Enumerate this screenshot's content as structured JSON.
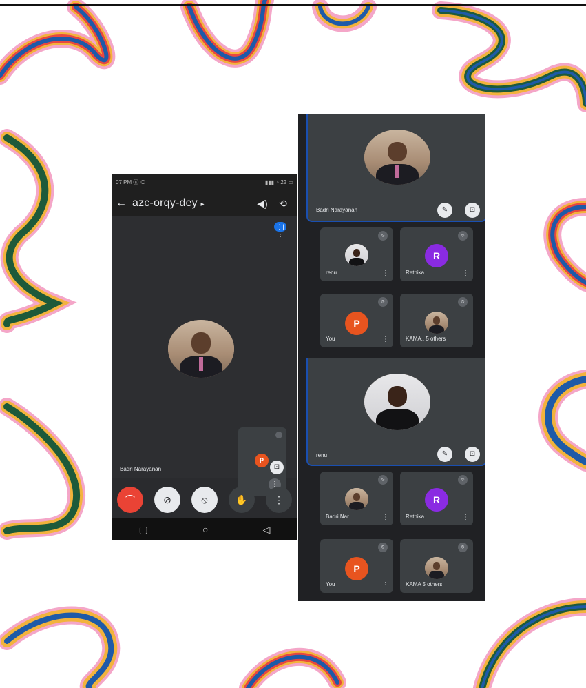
{
  "colors": {
    "accent": "#1a73e8",
    "end_call": "#ea4335",
    "avatar_orange": "#e8541f",
    "avatar_purple": "#8a2be2"
  },
  "phone": {
    "status_left": "07 PM ⓖ ⊙",
    "status_right": "▮▮▮ ◔ 22 ▭",
    "meeting_code": "azc-orqy-dey",
    "meeting_code_chevron": "▸",
    "back_icon": "←",
    "speaker_icon": "◀)",
    "switch_camera_icon": "⟲",
    "speaking_indicator": "⋮|⋮",
    "self_letter": "P",
    "self_more": "⋮",
    "main_name": "Badri Narayanan",
    "pin_icon": "⊡",
    "controls": {
      "end_call": "⌒",
      "camera_off": "⊘",
      "mic_off": "⦸",
      "raise_hand": "✋",
      "more": "⋮"
    },
    "nav": {
      "square": "▢",
      "circle": "○",
      "back": "◁"
    }
  },
  "panel_top": {
    "main_name": "Badri Narayanan",
    "tiles": [
      {
        "name": "renu",
        "letter": ""
      },
      {
        "name": "Rethika",
        "letter": "R"
      },
      {
        "name": "You",
        "letter": "P"
      },
      {
        "name": "KAMA.. 5 others",
        "letter": ""
      }
    ]
  },
  "panel_bottom": {
    "main_name": "renu",
    "tiles": [
      {
        "name": "Badri Nar..",
        "letter": ""
      },
      {
        "name": "Rethika",
        "letter": "R"
      },
      {
        "name": "You",
        "letter": "P"
      },
      {
        "name": "KAMA 5 others",
        "letter": ""
      }
    ]
  },
  "icons": {
    "mic_off": "⦸",
    "more": "⋮",
    "pin": "⊡",
    "mute": "✎"
  }
}
